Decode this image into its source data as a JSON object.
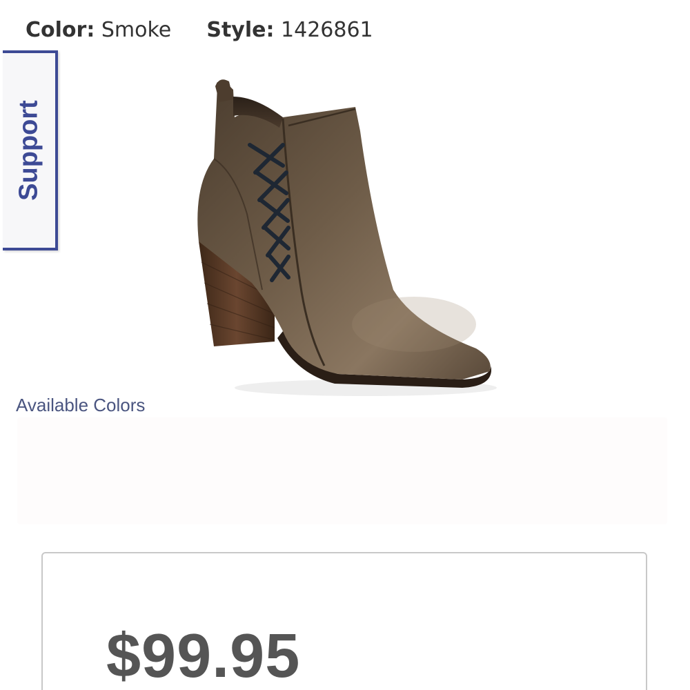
{
  "product_meta": {
    "color_label": "Color:",
    "color_value": "Smoke",
    "style_label": "Style:",
    "style_value": "1426861"
  },
  "support_tab": {
    "label": "Support"
  },
  "product_image": {
    "icon": "ankle-boot-image",
    "colors": {
      "leather": "#5b4a38",
      "heel": "#5a3b26",
      "lace": "#1e2733"
    }
  },
  "available_colors": {
    "label": "Available Colors"
  },
  "price": {
    "amount": "$99.95"
  },
  "colors": {
    "accent": "#3d4a95",
    "price_text": "#555555",
    "link_text": "#4a5580"
  }
}
